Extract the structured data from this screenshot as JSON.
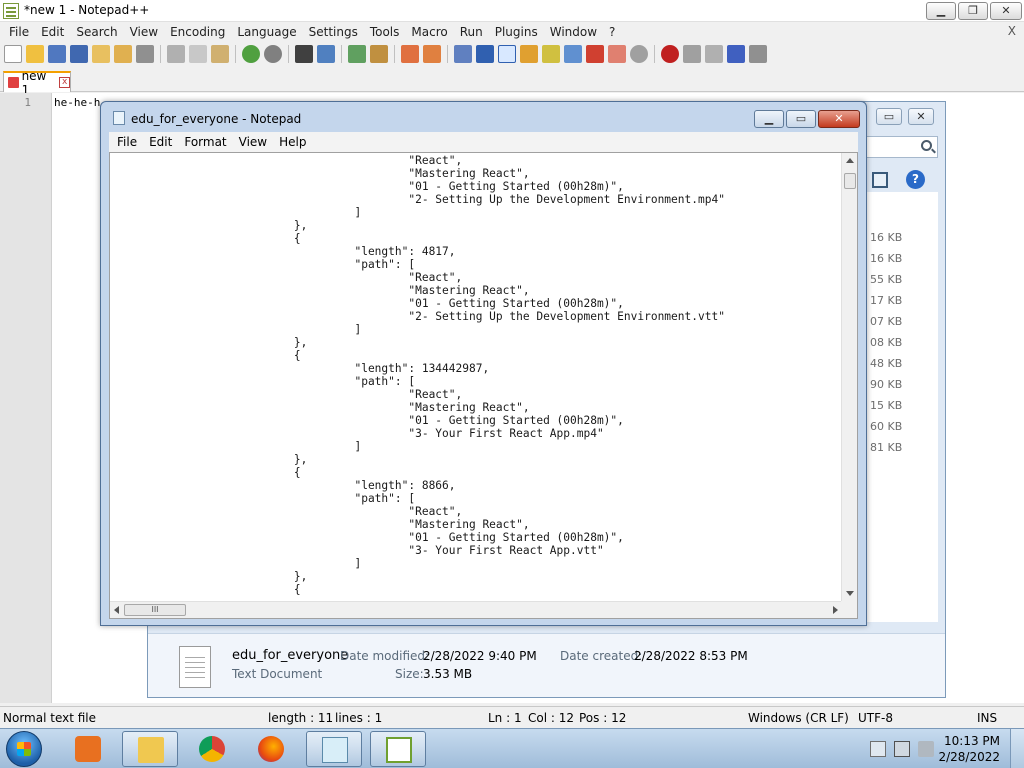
{
  "npp": {
    "title": "*new 1 - Notepad++",
    "menu": [
      "File",
      "Edit",
      "Search",
      "View",
      "Encoding",
      "Language",
      "Settings",
      "Tools",
      "Macro",
      "Run",
      "Plugins",
      "Window",
      "?"
    ],
    "menu_close": "X",
    "tab_label": "new 1",
    "tab_close": "x",
    "line_number": "1",
    "editor_text": "he-he-h",
    "status": {
      "file_type": "Normal text file",
      "length": "length : 11",
      "lines": "lines : 1",
      "ln": "Ln : 1",
      "col": "Col : 12",
      "pos": "Pos : 12",
      "eol": "Windows (CR LF)",
      "encoding": "UTF-8",
      "mode": "INS"
    }
  },
  "explorer": {
    "sizes": [
      "16 KB",
      "16 KB",
      "55 KB",
      "17 KB",
      "07 KB",
      "08 KB",
      "48 KB",
      "90 KB",
      "15 KB",
      "60 KB",
      "81 KB"
    ],
    "details": {
      "file_name": "edu_for_everyone",
      "file_type": "Text Document",
      "modified_label": "Date modified:",
      "modified_value": "2/28/2022 9:40 PM",
      "created_label": "Date created:",
      "created_value": "2/28/2022 8:53 PM",
      "size_label": "Size:",
      "size_value": "3.53 MB"
    }
  },
  "notepad": {
    "title": "edu_for_everyone - Notepad",
    "menu": [
      "File",
      "Edit",
      "Format",
      "View",
      "Help"
    ],
    "content": "                                            \"React\",\n                                            \"Mastering React\",\n                                            \"01 - Getting Started (00h28m)\",\n                                            \"2- Setting Up the Development Environment.mp4\"\n                                    ]\n                           },\n                           {\n                                    \"length\": 4817,\n                                    \"path\": [\n                                            \"React\",\n                                            \"Mastering React\",\n                                            \"01 - Getting Started (00h28m)\",\n                                            \"2- Setting Up the Development Environment.vtt\"\n                                    ]\n                           },\n                           {\n                                    \"length\": 134442987,\n                                    \"path\": [\n                                            \"React\",\n                                            \"Mastering React\",\n                                            \"01 - Getting Started (00h28m)\",\n                                            \"3- Your First React App.mp4\"\n                                    ]\n                           },\n                           {\n                                    \"length\": 8866,\n                                    \"path\": [\n                                            \"React\",\n                                            \"Mastering React\",\n                                            \"01 - Getting Started (00h28m)\",\n                                            \"3- Your First React App.vtt\"\n                                    ]\n                           },\n                           {",
    "hscroll_grip": "III"
  },
  "taskbar": {
    "apps": [
      "media-player-icon",
      "file-explorer-icon",
      "chrome-icon",
      "firefox-icon",
      "notepad-icon",
      "notepadplusplus-icon"
    ],
    "time": "10:13 PM",
    "date": "2/28/2022"
  },
  "colors": {
    "accent_tab": "#f4a000",
    "notepad_frame": "#c4d6ec",
    "close_red": "#c33a1e",
    "taskbar": "#9fbcd9"
  }
}
